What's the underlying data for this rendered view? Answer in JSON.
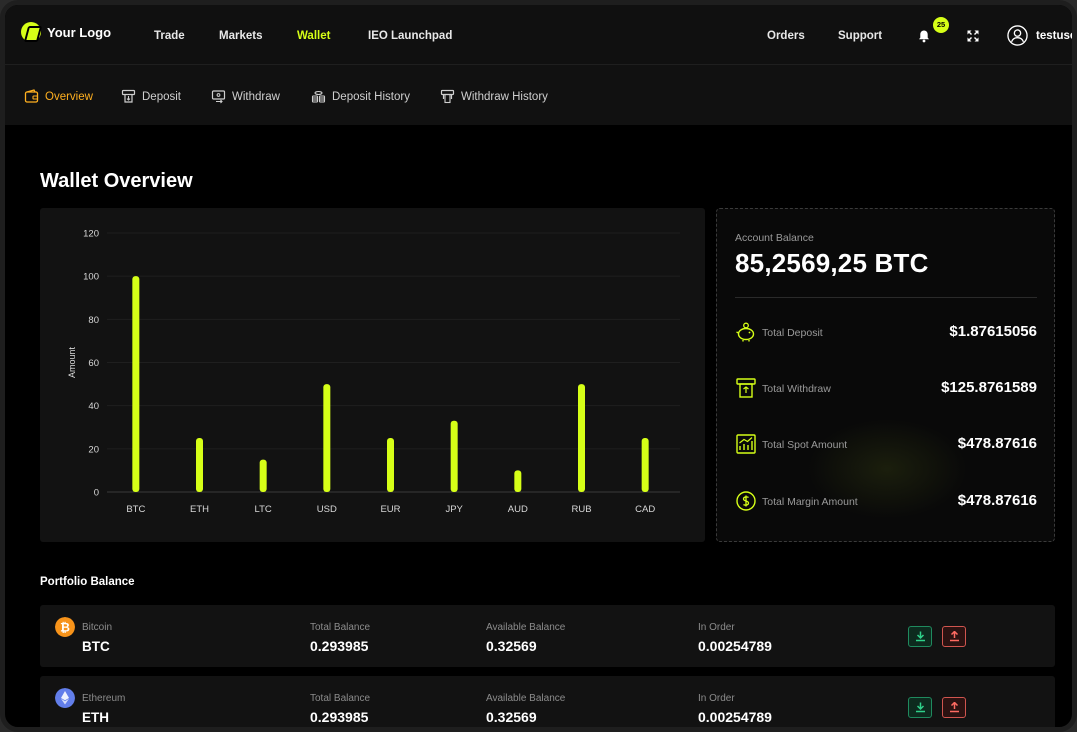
{
  "topnav": {
    "logo_text": "Your Logo",
    "items": [
      "Trade",
      "Markets",
      "Wallet",
      "IEO Launchpad"
    ],
    "active": "Wallet",
    "right_items": [
      "Orders",
      "Support"
    ],
    "notification_count": "25",
    "username": "testuser",
    "icons": [
      "bell-icon",
      "expand-icon",
      "user-avatar-icon"
    ]
  },
  "subnav": {
    "items": [
      {
        "label": "Overview",
        "icon": "wallet-icon"
      },
      {
        "label": "Deposit",
        "icon": "deposit-icon"
      },
      {
        "label": "Withdraw",
        "icon": "withdraw-icon"
      },
      {
        "label": "Deposit History",
        "icon": "coins-icon"
      },
      {
        "label": "Withdraw History",
        "icon": "atm-icon"
      }
    ],
    "active": "Overview"
  },
  "page_title": "Wallet Overview",
  "chart_data": {
    "type": "bar",
    "categories": [
      "BTC",
      "ETH",
      "LTC",
      "USD",
      "EUR",
      "JPY",
      "AUD",
      "RUB",
      "CAD"
    ],
    "values": [
      100,
      25,
      15,
      50,
      25,
      33,
      10,
      50,
      25
    ],
    "title": "",
    "xlabel": "",
    "ylabel": "Amount",
    "ylim": [
      0,
      120
    ],
    "yticks": [
      0,
      20,
      40,
      60,
      80,
      100,
      120
    ],
    "grid": true,
    "bar_color": "#d6ff17"
  },
  "balance": {
    "label": "Account Balance",
    "value": "85,2569,25 BTC",
    "stats": [
      {
        "label": "Total Deposit",
        "value": "$1.87615056",
        "icon": "piggy-bank-icon"
      },
      {
        "label": "Total Withdraw",
        "value": "$125.8761589",
        "icon": "atm-icon"
      },
      {
        "label": "Total Spot Amount",
        "value": "$478.87616",
        "icon": "chart-icon"
      },
      {
        "label": "Total Margin Amount",
        "value": "$478.87616",
        "icon": "dollar-coin-icon"
      }
    ]
  },
  "portfolio": {
    "title": "Portfolio Balance",
    "columns": {
      "total": "Total Balance",
      "available": "Available Balance",
      "in_order": "In Order"
    },
    "rows": [
      {
        "name": "Bitcoin",
        "symbol": "BTC",
        "total": "0.293985",
        "available": "0.32569",
        "in_order": "0.00254789",
        "icon": "bitcoin-icon",
        "color": "#f7931a"
      },
      {
        "name": "Ethereum",
        "symbol": "ETH",
        "total": "0.293985",
        "available": "0.32569",
        "in_order": "0.00254789",
        "icon": "ethereum-icon",
        "color": "#627eea"
      }
    ]
  },
  "colors": {
    "accent": "#d6ff17",
    "active_sub": "#ffb020",
    "deposit": "#1f8a5e",
    "withdraw": "#d0554f"
  }
}
